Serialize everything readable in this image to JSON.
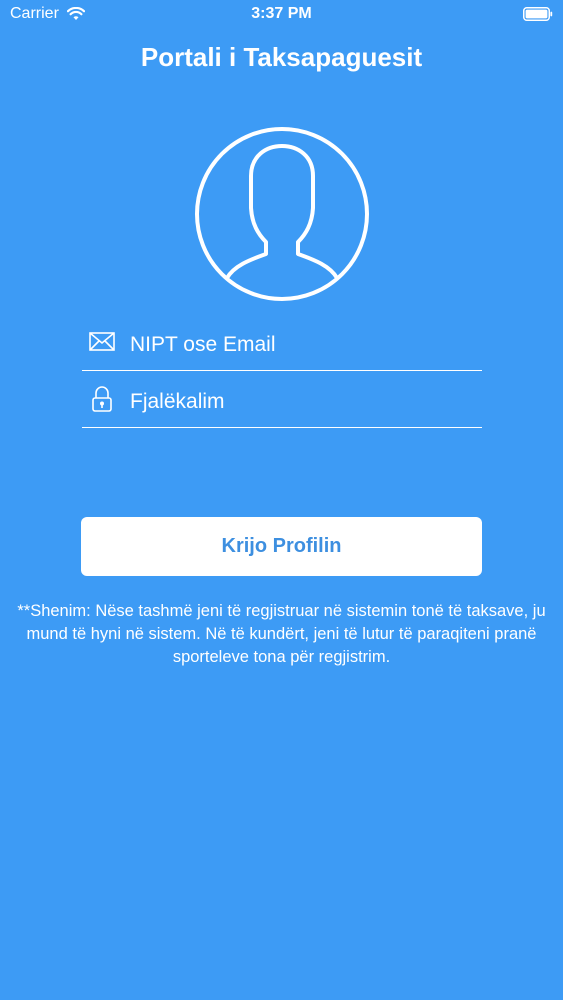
{
  "status_bar": {
    "carrier": "Carrier",
    "time": "3:37 PM",
    "icons": [
      "wifi-icon",
      "battery-icon"
    ]
  },
  "header": {
    "title": "Portali i Taksapaguesit"
  },
  "avatar": {
    "icon": "user-silhouette-icon"
  },
  "login_form": {
    "email": {
      "icon": "envelope-icon",
      "placeholder": "NIPT ose Email",
      "value": ""
    },
    "password": {
      "icon": "lock-icon",
      "placeholder": "Fjalëkalim",
      "value": ""
    }
  },
  "actions": {
    "create_profile_label": "Krijo Profilin"
  },
  "note": {
    "text": "**Shenim: Nëse tashmë jeni të regjistruar në sistemin tonë të taksave, ju mund të hyni në sistem. Në të kundërt, jeni të lutur të paraqiteni pranë sporteleve tona për regjistrim."
  },
  "colors": {
    "background": "#3d9bf5",
    "button_text": "#3d8fe0",
    "foreground": "#ffffff"
  }
}
